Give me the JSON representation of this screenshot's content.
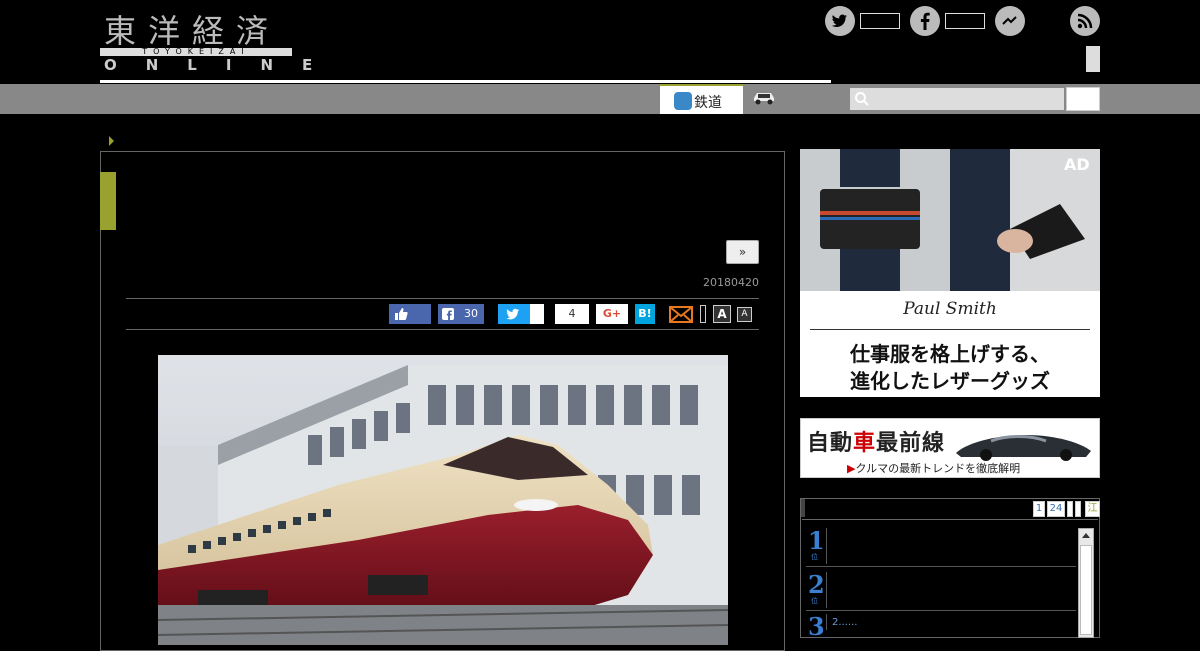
{
  "header": {
    "logo_kanji": "東洋経済",
    "logo_sub": "TOYOKEIZAI",
    "logo_online": "ONLINE"
  },
  "nav": {
    "tabs": [
      {
        "label": "鉄道",
        "icon": "train-icon",
        "active": true
      },
      {
        "label": "",
        "icon": "car-icon",
        "active": false
      }
    ],
    "search_placeholder": ""
  },
  "article": {
    "next_label": "»",
    "date": "20180420",
    "share": {
      "facebook_count": "30",
      "pocket_count": "4",
      "gplus_label": "G+",
      "hatena_label": "B!"
    },
    "font_large": "A",
    "font_small": "A"
  },
  "sidebar": {
    "ad": {
      "label": "AD",
      "brand": "Paul Smith",
      "copy_line1": "仕事服を格上げする、",
      "copy_line2": "進化したレザーグッズ"
    },
    "banner": {
      "title_a": "自動",
      "title_red": "車",
      "title_b": "最前線",
      "subtitle": "クルマの最新トレンドを徹底解明"
    },
    "ranking": {
      "tabs": [
        "1",
        "24",
        "",
        "",
        "江"
      ],
      "items": [
        {
          "rank": "1",
          "text": ""
        },
        {
          "rank": "2",
          "text": ""
        },
        {
          "rank": "3",
          "text": "2......"
        }
      ],
      "rank_suffix": "位"
    }
  },
  "colors": {
    "accent": "#9aa22f",
    "nav_gray": "#888888",
    "rank_blue": "#3a7fd0"
  }
}
